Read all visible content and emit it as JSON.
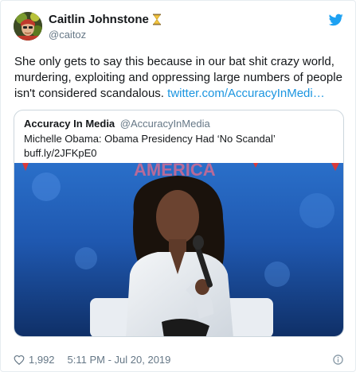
{
  "author": {
    "display_name": "Caitlin Johnstone",
    "handle": "@caitoz",
    "badge_icon": "hourglass-icon"
  },
  "tweet": {
    "text": "She only gets to say this because in our bat shit crazy world, murdering, exploiting and oppressing large numbers of people isn't considered scandalous.",
    "link_text": "twitter.com/AccuracyInMedi…"
  },
  "quoted_tweet": {
    "display_name": "Accuracy In Media",
    "handle": "@AccuracyInMedia",
    "line1": "Michelle Obama: Obama Presidency Had ‘No Scandal’",
    "line2": "buff.ly/2JFKpE0",
    "banner_text": "AMERICA"
  },
  "footer": {
    "like_count": "1,992",
    "timestamp": "5:11 PM - Jul 20, 2019"
  },
  "colors": {
    "link": "#1b95e0",
    "twitter_blue": "#1da1f2",
    "secondary_text": "#657786"
  }
}
